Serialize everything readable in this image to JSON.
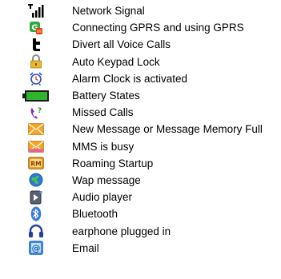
{
  "icons": [
    {
      "icon": "network-signal-icon",
      "label": "Network Signal"
    },
    {
      "icon": "gprs-icon",
      "label": "Connecting GPRS and using GPRS"
    },
    {
      "icon": "divert-calls-icon",
      "label": "Divert all Voice Calls"
    },
    {
      "icon": "keypad-lock-icon",
      "label": "Auto Keypad Lock"
    },
    {
      "icon": "alarm-clock-icon",
      "label": "Alarm Clock is activated"
    },
    {
      "icon": "battery-icon",
      "label": "Battery States"
    },
    {
      "icon": "missed-calls-icon",
      "label": "Missed Calls"
    },
    {
      "icon": "new-message-icon",
      "label": "New Message or Message Memory Full"
    },
    {
      "icon": "mms-busy-icon",
      "label": "MMS is busy"
    },
    {
      "icon": "roaming-icon",
      "label": "Roaming Startup",
      "badge": "RM"
    },
    {
      "icon": "wap-message-icon",
      "label": "Wap message"
    },
    {
      "icon": "audio-player-icon",
      "label": "Audio player"
    },
    {
      "icon": "bluetooth-icon",
      "label": "Bluetooth"
    },
    {
      "icon": "earphone-icon",
      "label": "earphone plugged in"
    },
    {
      "icon": "email-icon",
      "label": "Email",
      "badge": "@"
    }
  ],
  "colors": {
    "battery_green": "#2db52d",
    "envelope_orange": "#f5a623",
    "lock_gold": "#e8b730",
    "roaming_orange": "#f0a020",
    "globe_blue": "#2a7fd4",
    "bluetooth_blue": "#3b7be0",
    "earphone_blue": "#1f3f9f",
    "email_blue": "#3f8fe0",
    "missed_purple": "#7a2fc9"
  }
}
